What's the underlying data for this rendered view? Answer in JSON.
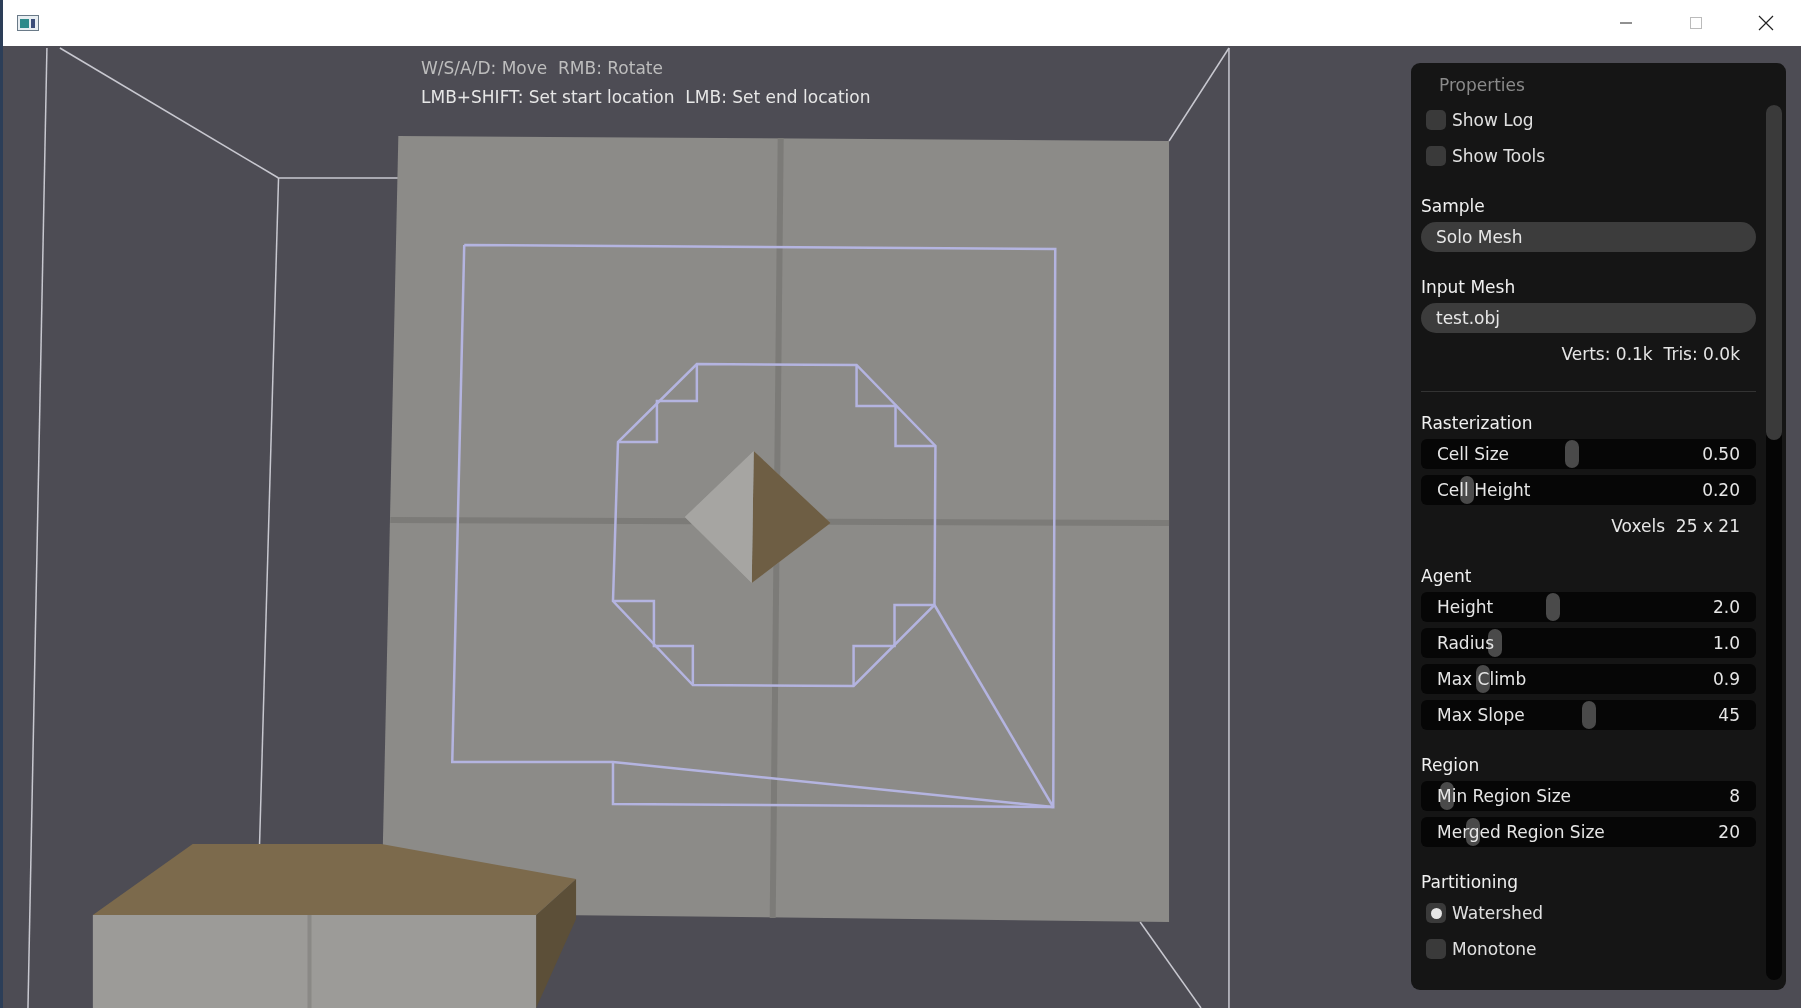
{
  "help_lines": [
    "W/S/A/D: Move  RMB: Rotate",
    "LMB+SHIFT: Set start location  LMB: Set end location"
  ],
  "properties": {
    "title": "Properties",
    "items": [
      {
        "kind": "checkbox",
        "label": "Show Log",
        "checked": false
      },
      {
        "kind": "checkbox",
        "label": "Show Tools",
        "checked": false
      },
      {
        "kind": "header",
        "label": "Sample"
      },
      {
        "kind": "dropdown",
        "value": "Solo Mesh"
      },
      {
        "kind": "header",
        "label": "Input Mesh"
      },
      {
        "kind": "dropdown",
        "value": "test.obj"
      },
      {
        "kind": "info",
        "text": "Verts: 0.1k  Tris: 0.0k"
      },
      {
        "kind": "separator"
      },
      {
        "kind": "header",
        "label": "Rasterization"
      },
      {
        "kind": "slider",
        "label": "Cell Size",
        "value": "0.50",
        "level": 0.45
      },
      {
        "kind": "slider",
        "label": "Cell Height",
        "value": "0.20",
        "level": 0.12
      },
      {
        "kind": "info",
        "text": "Voxels  25 x 21"
      },
      {
        "kind": "header",
        "label": "Agent"
      },
      {
        "kind": "slider",
        "label": "Height",
        "value": "2.0",
        "level": 0.39
      },
      {
        "kind": "slider",
        "label": "Radius",
        "value": "1.0",
        "level": 0.21
      },
      {
        "kind": "slider",
        "label": "Max Climb",
        "value": "0.9",
        "level": 0.17
      },
      {
        "kind": "slider",
        "label": "Max Slope",
        "value": "45",
        "level": 0.5
      },
      {
        "kind": "header",
        "label": "Region"
      },
      {
        "kind": "slider",
        "label": "Min Region Size",
        "value": "8",
        "level": 0.06
      },
      {
        "kind": "slider",
        "label": "Merged Region Size",
        "value": "20",
        "level": 0.14
      },
      {
        "kind": "header",
        "label": "Partitioning"
      },
      {
        "kind": "radio",
        "label": "Watershed",
        "selected": true
      },
      {
        "kind": "radio",
        "label": "Monotone",
        "selected": false
      }
    ]
  }
}
